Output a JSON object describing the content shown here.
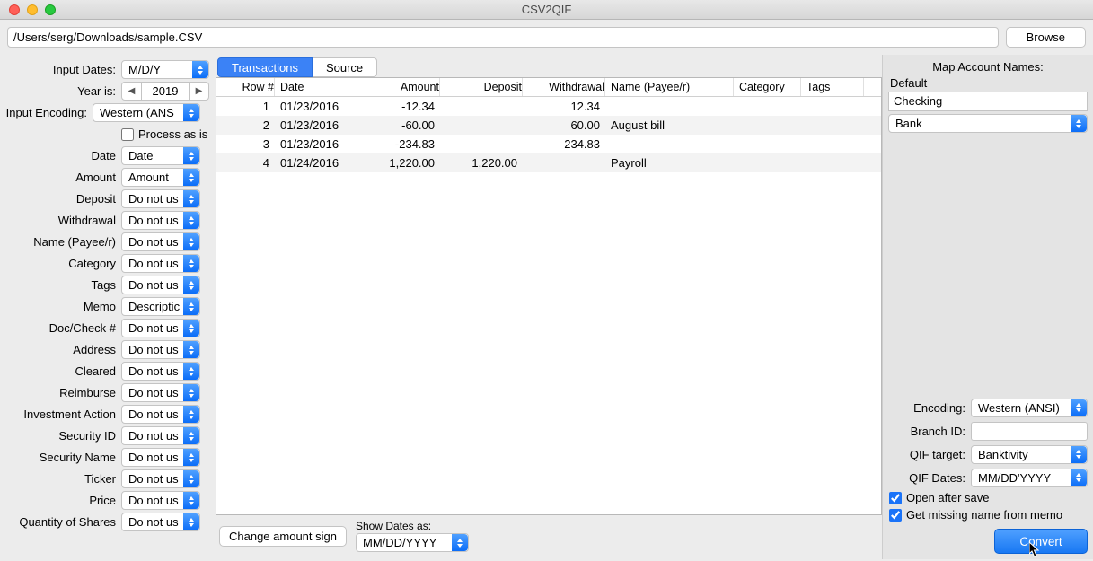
{
  "window_title": "CSV2QIF",
  "path": "/Users/serg/Downloads/sample.CSV",
  "browse_label": "Browse",
  "input": {
    "dates_label": "Input Dates:",
    "dates_value": "M/D/Y",
    "year_label": "Year is:",
    "year_value": "2019",
    "encoding_label": "Input Encoding:",
    "encoding_value": "Western (ANS",
    "process_as_is_label": "Process as is"
  },
  "fields": [
    {
      "label": "Date",
      "value": "Date"
    },
    {
      "label": "Amount",
      "value": "Amount"
    },
    {
      "label": "Deposit",
      "value": "Do not us"
    },
    {
      "label": "Withdrawal",
      "value": "Do not us"
    },
    {
      "label": "Name (Payee/r)",
      "value": "Do not us"
    },
    {
      "label": "Category",
      "value": "Do not us"
    },
    {
      "label": "Tags",
      "value": "Do not us"
    },
    {
      "label": "Memo",
      "value": "Descriptic"
    },
    {
      "label": "Doc/Check #",
      "value": "Do not us"
    },
    {
      "label": "Address",
      "value": "Do not us"
    },
    {
      "label": "Cleared",
      "value": "Do not us"
    },
    {
      "label": "Reimburse",
      "value": "Do not us"
    },
    {
      "label": "Investment Action",
      "value": "Do not us"
    },
    {
      "label": "Security ID",
      "value": "Do not us"
    },
    {
      "label": "Security Name",
      "value": "Do not us"
    },
    {
      "label": "Ticker",
      "value": "Do not us"
    },
    {
      "label": "Price",
      "value": "Do not us"
    },
    {
      "label": "Quantity of Shares",
      "value": "Do not us"
    }
  ],
  "tabs": [
    "Transactions",
    "Source"
  ],
  "tabs_active": 0,
  "grid": {
    "headers": [
      "Row #",
      "Date",
      "Amount",
      "Deposit",
      "Withdrawal",
      "Name (Payee/r)",
      "Category",
      "Tags"
    ],
    "rows": [
      {
        "rownum": "1",
        "date": "01/23/2016",
        "amount": "-12.34",
        "deposit": "",
        "withdrawal": "12.34",
        "name": "",
        "category": "",
        "tags": ""
      },
      {
        "rownum": "2",
        "date": "01/23/2016",
        "amount": "-60.00",
        "deposit": "",
        "withdrawal": "60.00",
        "name": "August bill",
        "category": "",
        "tags": ""
      },
      {
        "rownum": "3",
        "date": "01/23/2016",
        "amount": "-234.83",
        "deposit": "",
        "withdrawal": "234.83",
        "name": "",
        "category": "",
        "tags": ""
      },
      {
        "rownum": "4",
        "date": "01/24/2016",
        "amount": "1,220.00",
        "deposit": "1,220.00",
        "withdrawal": "",
        "name": "Payroll",
        "category": "",
        "tags": ""
      }
    ]
  },
  "bottom": {
    "change_sign_label": "Change amount sign",
    "show_dates_label": "Show Dates as:",
    "show_dates_value": "MM/DD/YYYY"
  },
  "right": {
    "map_title": "Map Account Names:",
    "default_label": "Default",
    "account_name": "Checking",
    "account_type": "Bank",
    "encoding_label": "Encoding:",
    "encoding_value": "Western (ANSI)",
    "branch_label": "Branch ID:",
    "branch_value": "",
    "target_label": "QIF target:",
    "target_value": "Banktivity",
    "qifdates_label": "QIF Dates:",
    "qifdates_value": "MM/DD'YYYY",
    "open_after_label": "Open after save",
    "missing_name_label": "Get missing name from memo",
    "convert_label": "Convert"
  }
}
